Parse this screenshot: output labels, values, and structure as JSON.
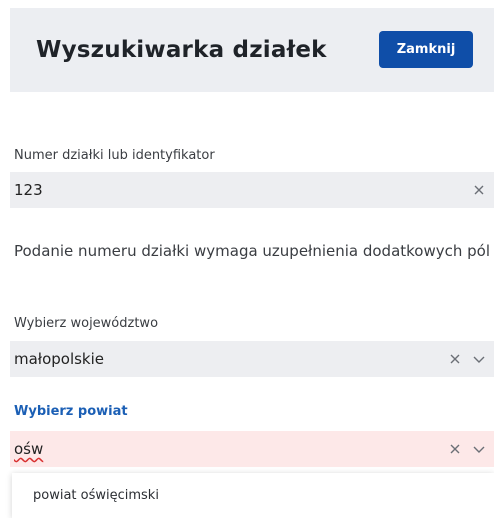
{
  "header": {
    "title": "Wyszukiwarka działek",
    "close_label": "Zamknij"
  },
  "parcel": {
    "label": "Numer działki lub identyfikator",
    "value": "123",
    "info": "Podanie numeru działki wymaga uzupełnienia dodatkowych pól"
  },
  "voivodeship": {
    "label": "Wybierz województwo",
    "value": "małopolskie"
  },
  "county": {
    "label": "Wybierz powiat",
    "value": "ośw",
    "options": [
      "powiat oświęcimski"
    ]
  },
  "colors": {
    "accent": "#0f4ea8",
    "header_bg": "#eceef2",
    "field_bg": "#edeef1",
    "error_bg": "#fde8e8"
  }
}
